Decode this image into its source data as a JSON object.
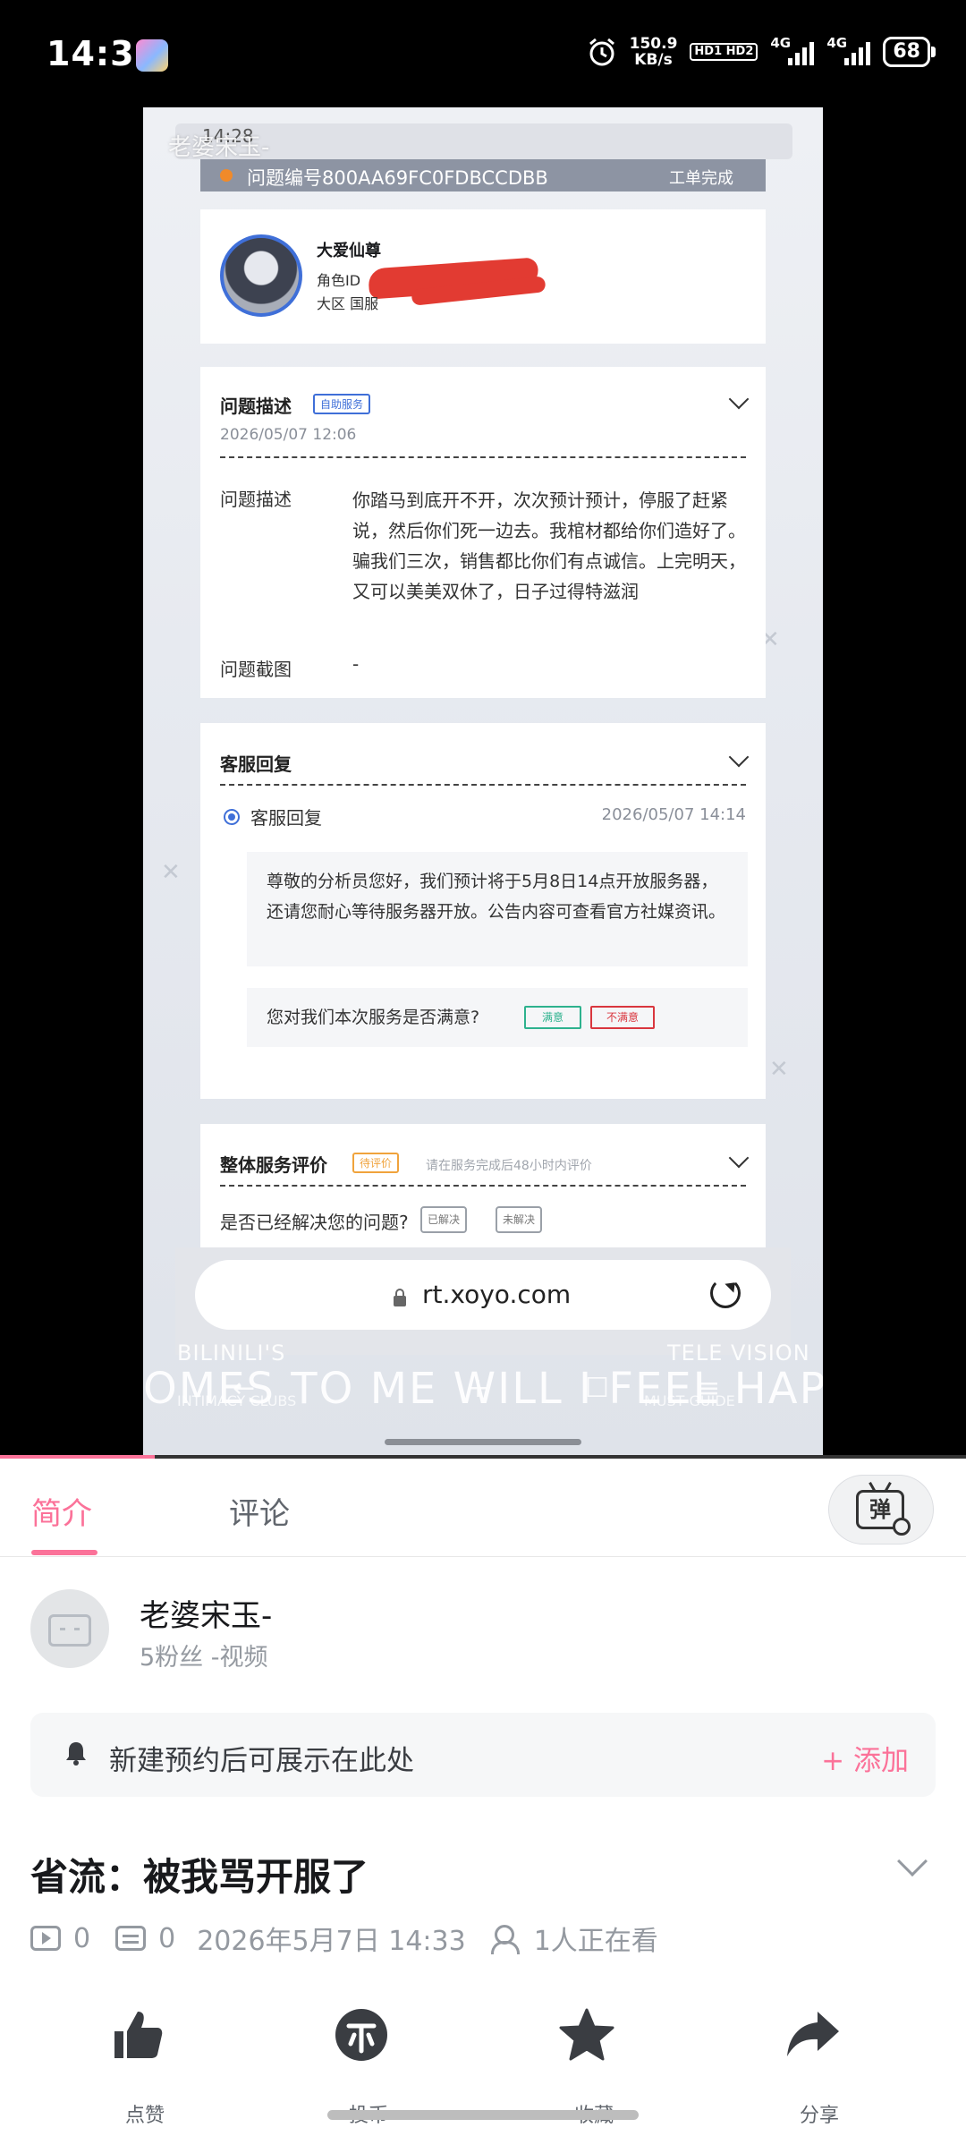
{
  "status_bar": {
    "time": "14:34",
    "net_speed_value": "150.9",
    "net_speed_unit": "KB/s",
    "hd_label": "HD1 HD2",
    "sim1": "4G",
    "sim2": "4G",
    "battery": "68",
    "icons": [
      "alarm-icon",
      "hd-icon",
      "signal-icon",
      "signal-icon",
      "battery-icon"
    ]
  },
  "video": {
    "uploader_watermark": "老婆宋玉-",
    "inner_status_time": "14:28",
    "ticket": {
      "number": "问题编号800AA69FC0FDBCCDBB",
      "status": "工单完成"
    },
    "profile": {
      "name": "大爱仙尊",
      "id_label": "角色ID",
      "zone": "大区  国服"
    },
    "description_section": {
      "title": "问题描述",
      "tag": "自助服务",
      "date": "2026/05/07 12:06",
      "desc_label": "问题描述",
      "desc_text": "你踏马到底开不开，次次预计预计，停服了赶紧说，然后你们死一边去。我棺材都给你们造好了。骗我们三次，销售都比你们有点诚信。上完明天，又可以美美双休了，日子过得特滋润",
      "screenshot_label": "问题截图",
      "screenshot_value": "-"
    },
    "reply_section": {
      "title": "客服回复",
      "reply_label": "客服回复",
      "reply_time": "2026/05/07 14:14",
      "reply_text": "尊敬的分析员您好，我们预计将于5月8日14点开放服务器，还请您耐心等待服务器开放。公告内容可查看官方社媒资讯。",
      "satisfaction_question": "您对我们本次服务是否满意?",
      "satisfied": "满意",
      "unsatisfied": "不满意"
    },
    "overall_section": {
      "title": "整体服务评价",
      "tag": "待评价",
      "hint": "请在服务完成后48小时内评价",
      "resolved_question": "是否已经解决您的问题?",
      "resolved": "已解决",
      "unresolved": "未解决"
    },
    "browser": {
      "url": "rt.xoyo.com"
    },
    "overlay": {
      "top_left": "BILINILI'S",
      "top_right": "TELE VISION",
      "lyrics": "OMES TO ME WILL I FEEL HAPP",
      "bottom_left": "INTIMACY CLUBS",
      "bottom_right": "MUST GUIDE"
    },
    "progress_fraction": 0.16
  },
  "panel": {
    "tabs": [
      {
        "label": "简介",
        "active": true
      },
      {
        "label": "评论",
        "active": false
      }
    ],
    "danmaku_button_label": "弹",
    "uploader": {
      "name": "老婆宋玉-",
      "stats": "5粉丝    -视频"
    },
    "reserve": {
      "text": "新建预约后可展示在此处",
      "add_label": "+ 添加"
    },
    "video_title": "省流：被我骂开服了",
    "meta": {
      "plays": "0",
      "danmaku": "0",
      "date": "2026年5月7日 14:33",
      "watching": "1人正在看"
    },
    "actions": [
      {
        "name": "like-icon",
        "label": "点赞"
      },
      {
        "name": "coin-icon",
        "label": "投币"
      },
      {
        "name": "favorite-icon",
        "label": "收藏"
      },
      {
        "name": "share-icon",
        "label": "分享"
      }
    ],
    "colors": {
      "accent": "#fb7299",
      "action_icon": "#3a3d42"
    }
  }
}
